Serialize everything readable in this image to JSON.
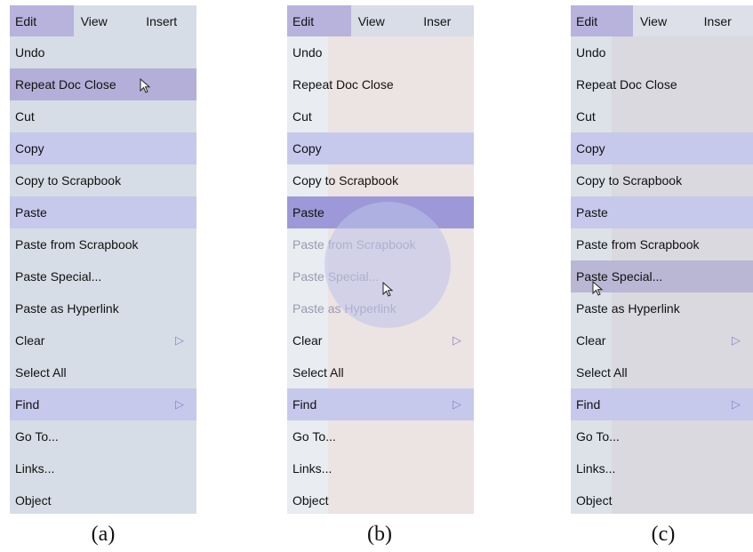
{
  "menubar": {
    "edit": "Edit",
    "view": "View",
    "insert_a": "Insert",
    "insert_b": "Inser",
    "insert_c": "Inser"
  },
  "menu_items": [
    "Undo",
    "Repeat Doc Close",
    "Cut",
    "Copy",
    "Copy to Scrapbook",
    "Paste",
    "Paste from Scrapbook",
    "Paste Special...",
    "Paste as Hyperlink",
    "Clear",
    "Select All",
    "Find",
    "Go To...",
    "Links...",
    "Object"
  ],
  "submenu_arrow": "▷",
  "captions": {
    "a": "(a)",
    "b": "(b)",
    "c": "(c)"
  },
  "colors": {
    "menu_bg_a": "#d6dde6",
    "menu_bg_b": "#ece3e3",
    "menu_bg_c": "#d9d9df",
    "highlight_light": "#c6c9ec",
    "highlight_selected": "#9d99d8"
  }
}
